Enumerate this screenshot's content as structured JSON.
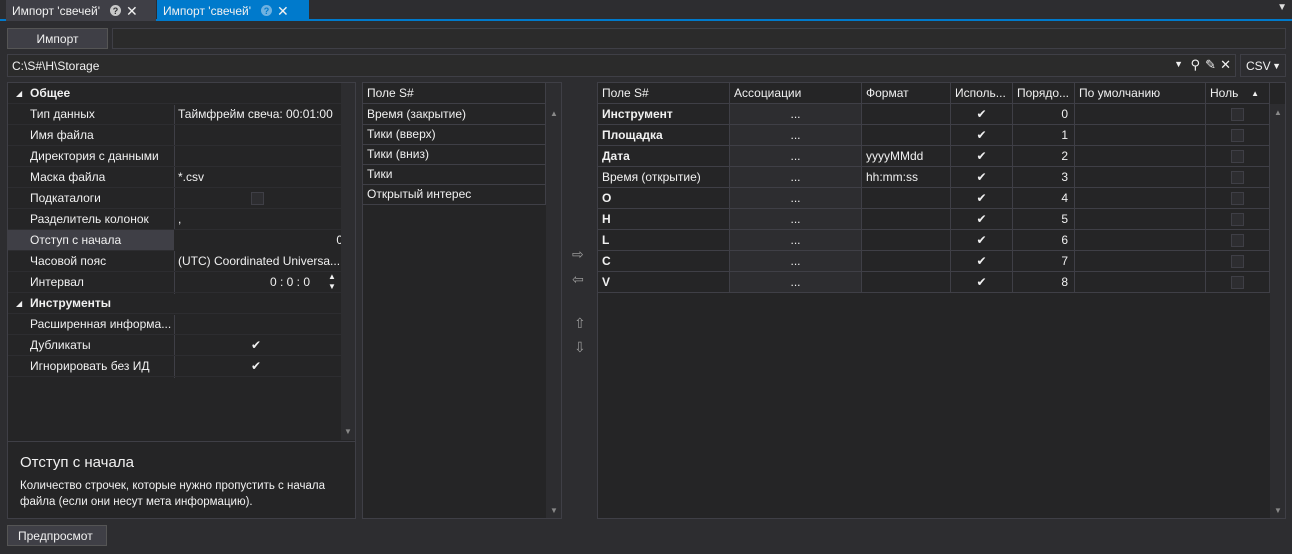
{
  "tabs": [
    {
      "label": "Импорт 'свечей'",
      "help": "?",
      "close": "✕"
    },
    {
      "label": "Импорт 'свечей'",
      "help": "?",
      "close": "✕"
    }
  ],
  "toolbar": {
    "import_label": "Импорт"
  },
  "path": {
    "value": "C:\\S#\\H\\Storage",
    "format": "CSV"
  },
  "properties": {
    "cat_general": "Общее",
    "cat_instruments": "Инструменты",
    "rows": [
      {
        "name": "Тип данных",
        "value": "Таймфрейм свеча: 00:01:00"
      },
      {
        "name": "Имя файла",
        "value": ""
      },
      {
        "name": "Директория с данными",
        "value": ""
      },
      {
        "name": "Маска файла",
        "value": "*.csv"
      },
      {
        "name": "Подкаталоги",
        "value": ""
      },
      {
        "name": "Разделитель колонок",
        "value": ","
      },
      {
        "name": "Отступ с начала",
        "value": "0"
      },
      {
        "name": "Часовой пояс",
        "value": "(UTC) Coordinated Universa..."
      },
      {
        "name": "Интервал",
        "value": "0 : 0 : 0"
      }
    ],
    "inst_rows": [
      {
        "name": "Расширенная информа...",
        "value": ""
      },
      {
        "name": "Дубликаты",
        "value": "✔"
      },
      {
        "name": "Игнорировать без ИД",
        "value": "✔"
      }
    ],
    "desc_title": "Отступ с начала",
    "desc_text": "Количество строчек, которые нужно пропустить с начала файла (если они несут мета информацию)."
  },
  "fields_list": {
    "header": "Поле S#",
    "items": [
      "Время (закрытие)",
      "Тики (вверх)",
      "Тики (вниз)",
      "Тики",
      "Открытый интерес"
    ]
  },
  "mapping": {
    "headers": [
      "Поле S#",
      "Ассоциации",
      "Формат",
      "Исполь...",
      "Порядо...",
      "По умолчанию",
      "Ноль"
    ],
    "rows": [
      {
        "field": "Инструмент",
        "bold": true,
        "assoc": "...",
        "format": "",
        "used": true,
        "order": "0"
      },
      {
        "field": "Площадка",
        "bold": true,
        "assoc": "...",
        "format": "",
        "used": true,
        "order": "1"
      },
      {
        "field": "Дата",
        "bold": true,
        "assoc": "...",
        "format": "yyyyMMdd",
        "used": true,
        "order": "2"
      },
      {
        "field": "Время (открытие)",
        "bold": false,
        "assoc": "...",
        "format": "hh:mm:ss",
        "used": true,
        "order": "3"
      },
      {
        "field": "O",
        "bold": true,
        "assoc": "...",
        "format": "",
        "used": true,
        "order": "4"
      },
      {
        "field": "H",
        "bold": true,
        "assoc": "...",
        "format": "",
        "used": true,
        "order": "5"
      },
      {
        "field": "L",
        "bold": true,
        "assoc": "...",
        "format": "",
        "used": true,
        "order": "6"
      },
      {
        "field": "C",
        "bold": true,
        "assoc": "...",
        "format": "",
        "used": true,
        "order": "7"
      },
      {
        "field": "V",
        "bold": true,
        "assoc": "...",
        "format": "",
        "used": true,
        "order": "8"
      }
    ]
  },
  "footer": {
    "preview_label": "Предпросмот"
  },
  "colors": {
    "accent": "#007acc",
    "background": "#2d2d30",
    "panel": "#252526"
  }
}
